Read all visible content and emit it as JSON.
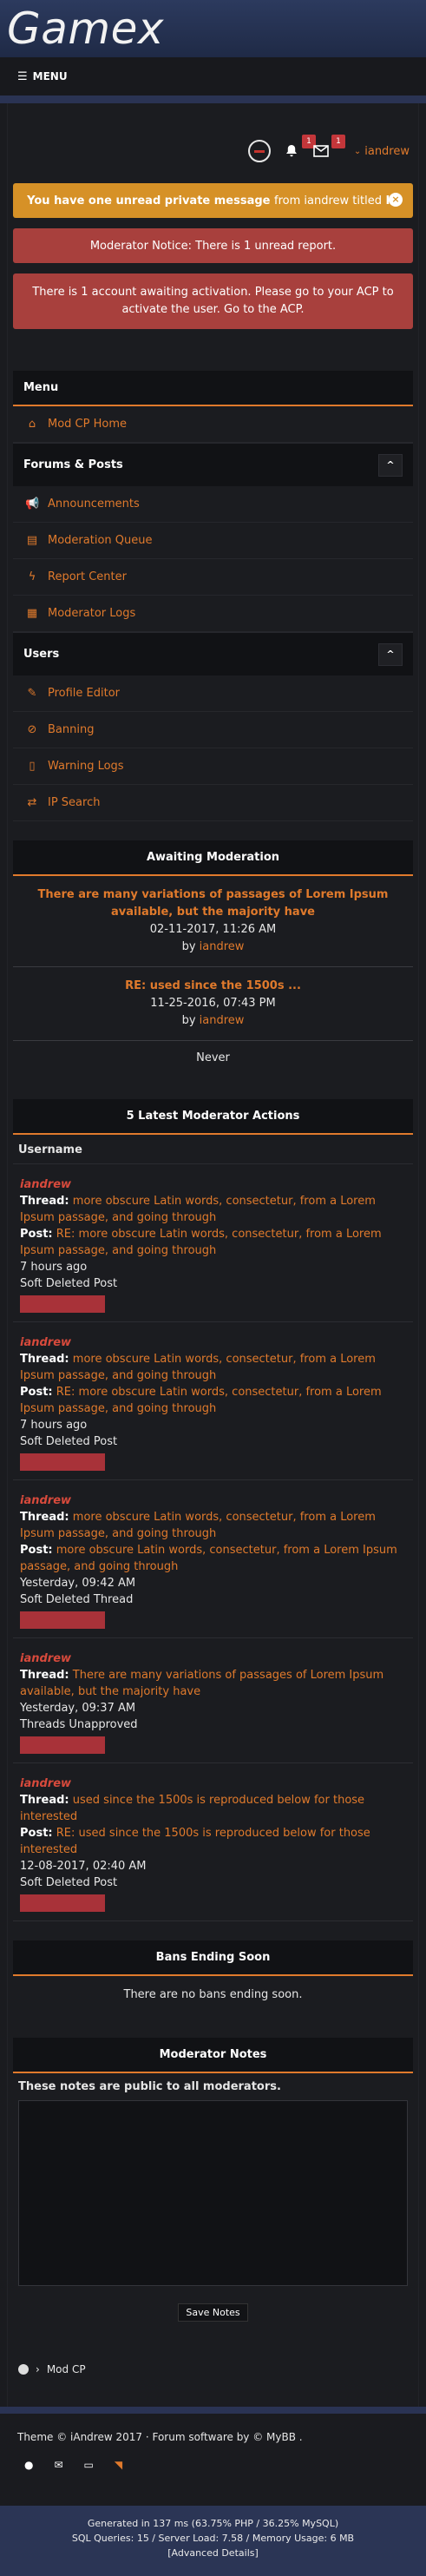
{
  "brand": {
    "logo_text": "Gamex"
  },
  "menu_bar": {
    "label": "MENU"
  },
  "userbar": {
    "notifications_count": "1",
    "pm_count": "1",
    "username": "iandrew"
  },
  "alerts": {
    "pm_prefix": "You have one unread private message",
    "pm_from": "from iandrew titled",
    "pm_title": "Hi",
    "mod_notice": "Moderator Notice: There is 1 unread report.",
    "acp_notice": "There is 1 account awaiting activation. Please go to your ACP to activate the user. Go to the ACP."
  },
  "side_menu": {
    "title": "Menu",
    "home": "Mod CP Home",
    "forums_section": "Forums & Posts",
    "forums_items": [
      "Announcements",
      "Moderation Queue",
      "Report Center",
      "Moderator Logs"
    ],
    "users_section": "Users",
    "users_items": [
      "Profile Editor",
      "Banning",
      "Warning Logs",
      "IP Search"
    ]
  },
  "awaiting": {
    "title": "Awaiting Moderation",
    "items": [
      {
        "title": "There are many variations of passages of Lorem Ipsum available, but the majority have",
        "date": "02-11-2017, 11:26 AM",
        "by": "by",
        "user": "iandrew"
      },
      {
        "title": "RE: used since the 1500s ...",
        "date": "11-25-2016, 07:43 PM",
        "by": "by",
        "user": "iandrew"
      }
    ],
    "last": "Never"
  },
  "latest_actions": {
    "title": "5 Latest Moderator Actions",
    "column": "Username",
    "thread_label": "Thread:",
    "post_label": "Post:",
    "items": [
      {
        "user": "iandrew",
        "thread": "more obscure Latin words, consectetur, from a Lorem Ipsum passage, and going through",
        "post": "RE: more obscure Latin words, consectetur, from a Lorem Ipsum passage, and going through",
        "time": "7 hours ago",
        "action": "Soft Deleted Post"
      },
      {
        "user": "iandrew",
        "thread": "more obscure Latin words, consectetur, from a Lorem Ipsum passage, and going through",
        "post": "RE: more obscure Latin words, consectetur, from a Lorem Ipsum passage, and going through",
        "time": "7 hours ago",
        "action": "Soft Deleted Post"
      },
      {
        "user": "iandrew",
        "thread": "more obscure Latin words, consectetur, from a Lorem Ipsum passage, and going through",
        "post": "more obscure Latin words, consectetur, from a Lorem Ipsum passage, and going through",
        "time": "Yesterday, 09:42 AM",
        "action": "Soft Deleted Thread"
      },
      {
        "user": "iandrew",
        "thread": "There are many variations of passages of Lorem Ipsum available, but the majority have",
        "post": "",
        "time": "Yesterday, 09:37 AM",
        "action": "Threads Unapproved"
      },
      {
        "user": "iandrew",
        "thread": "used since the 1500s is reproduced below for those interested",
        "post": "RE: used since the 1500s is reproduced below for those interested",
        "time": "12-08-2017, 02:40 AM",
        "action": "Soft Deleted Post"
      }
    ]
  },
  "bans": {
    "title": "Bans Ending Soon",
    "empty": "There are no bans ending soon."
  },
  "notes": {
    "title": "Moderator Notes",
    "hint": "These notes are public to all moderators.",
    "save": "Save Notes"
  },
  "breadcrumb": {
    "label": "Mod CP"
  },
  "footer": {
    "theme_text": "Theme © iAndrew 2017",
    "software_text": "Forum software by © MyBB .",
    "stats_line1": "Generated in 137 ms (63.75% PHP / 36.25% MySQL)",
    "stats_line2": "SQL Queries: 15 / Server Load: 7.58 / Memory Usage: 6 MB",
    "stats_line3": "[Advanced Details]"
  },
  "colors": {
    "accent": "#e07a2c",
    "pm_alert": "#d69127",
    "notice_alert": "#a8403d",
    "header": "#2c3a5e"
  }
}
